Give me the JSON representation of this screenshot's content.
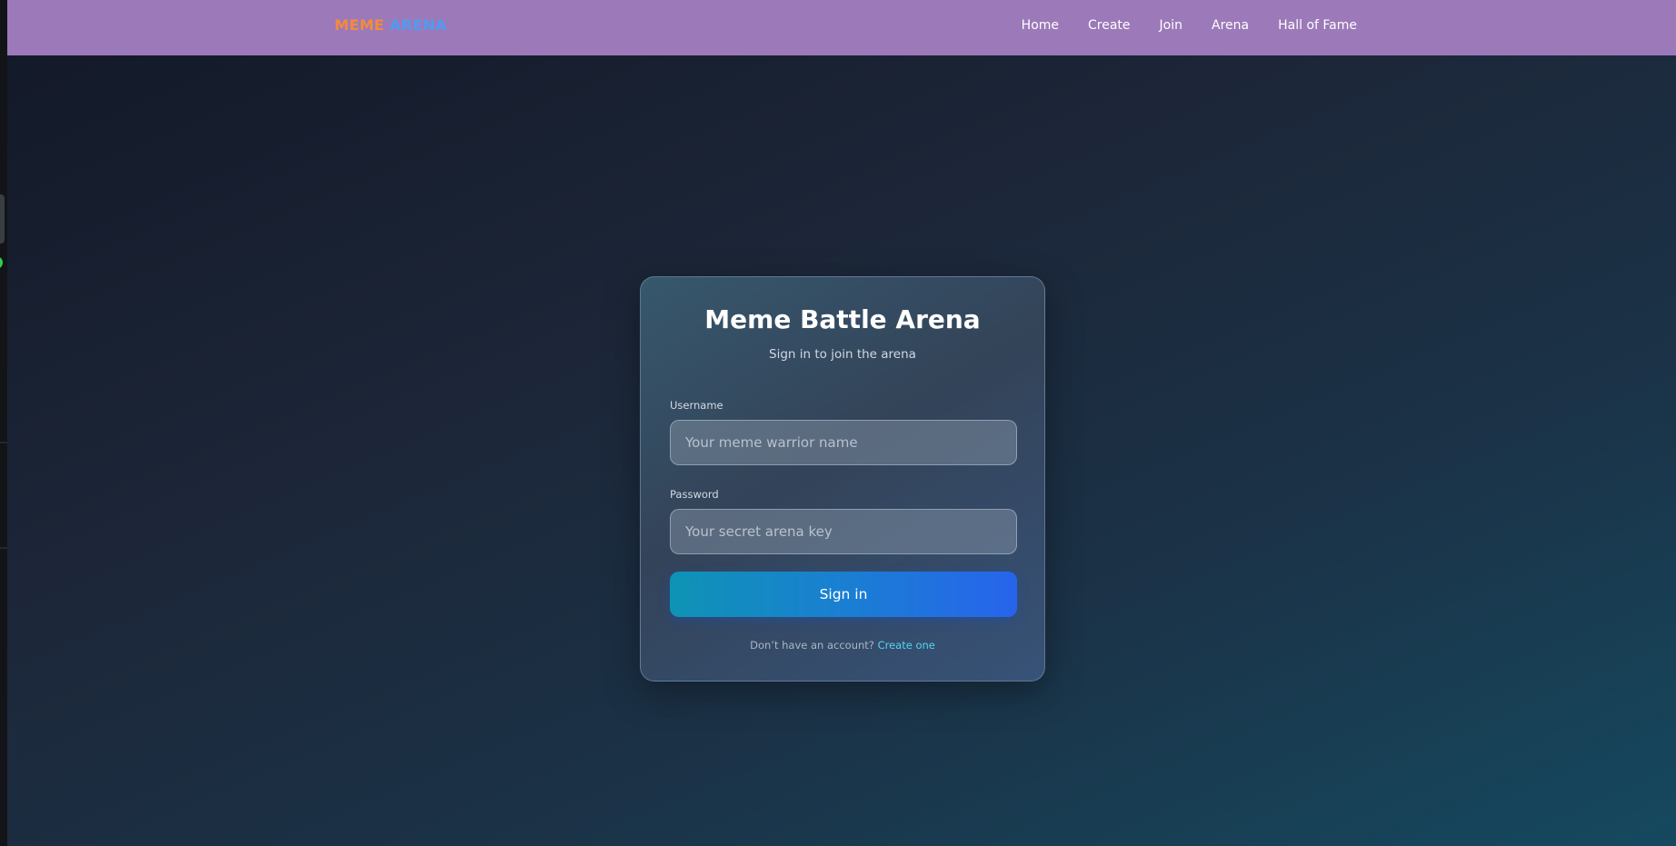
{
  "navbar": {
    "brand_part1": "MEME",
    "brand_part2": "ARENA",
    "links": [
      "Home",
      "Create",
      "Join",
      "Arena",
      "Hall of Fame"
    ]
  },
  "login": {
    "title": "Meme Battle Arena",
    "subtitle": "Sign in to join the arena",
    "username_label": "Username",
    "username_placeholder": "Your meme warrior name",
    "username_value": "",
    "password_label": "Password",
    "password_placeholder": "Your secret arena key",
    "password_value": "",
    "submit_label": "Sign in",
    "signup_prompt": "Don’t have an account?",
    "signup_link": "Create one"
  },
  "colors": {
    "navbar_bg": "#9c79b9",
    "brand_orange": "#f38b3a",
    "brand_blue": "#4f9cf2",
    "button_start": "#0e93b5",
    "button_end": "#2764ec",
    "link": "#53d6ee"
  }
}
